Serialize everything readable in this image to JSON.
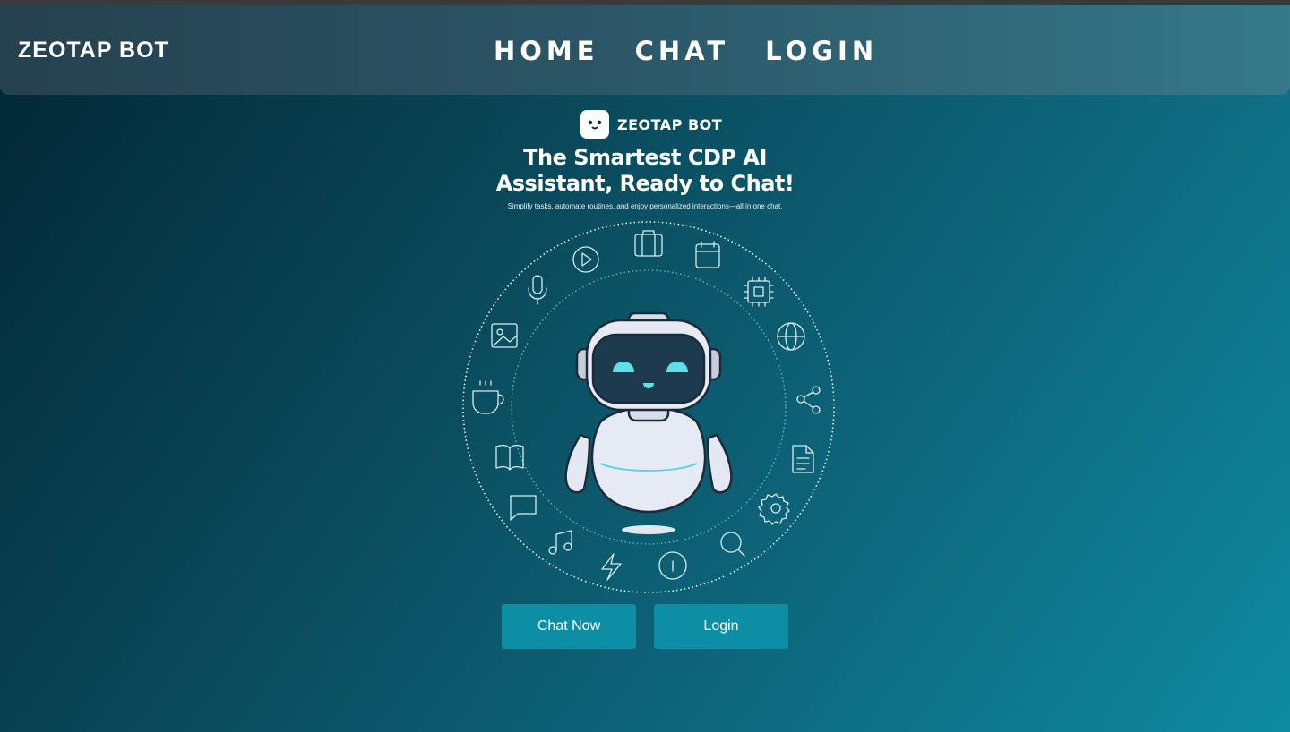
{
  "nav": {
    "brand": "ZEOTAP BOT",
    "links": [
      "HOME",
      "CHAT",
      "LOGIN"
    ]
  },
  "hero": {
    "logo_text": "ZEOTAP BOT",
    "title_line1": "The Smartest CDP AI",
    "title_line2": "Assistant, Ready to Chat!",
    "subtitle": "Simplify tasks, automate routines, and enjoy personalized interactions—all in one chat."
  },
  "buttons": {
    "chat_now": "Chat Now",
    "login": "Login"
  },
  "icons": [
    "play-icon",
    "briefcase-icon",
    "calendar-icon",
    "chip-icon",
    "globe-icon",
    "share-icon",
    "document-icon",
    "gear-icon",
    "search-icon",
    "info-icon",
    "lightning-icon",
    "music-icon",
    "chat-bubble-icon",
    "book-icon",
    "coffee-icon",
    "image-icon",
    "microphone-icon"
  ],
  "colors": {
    "button": "#0e8ea5",
    "accent_cyan": "#5fe0e8"
  }
}
